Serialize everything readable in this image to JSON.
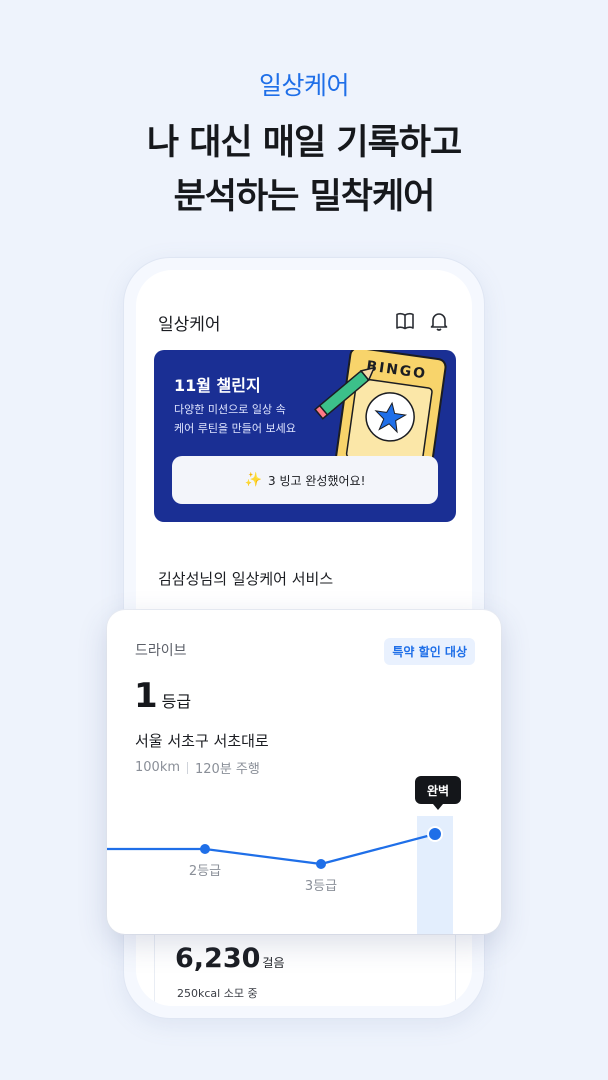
{
  "hero": {
    "eyebrow": "일상케어",
    "headline_line1": "나 대신 매일 기록하고",
    "headline_line2": "분석하는 밀착케어"
  },
  "app": {
    "title": "일상케어",
    "icons": [
      "book-icon",
      "bell-icon"
    ]
  },
  "banner": {
    "title": "11월 챌린지",
    "description_line1": "다양한 미션으로 일상 속",
    "description_line2": "케어 루틴을 만들어 보세요",
    "art_text": "BINGO",
    "button_label": "3 빙고 완성했어요!",
    "button_icon": "sparkle-icon"
  },
  "service": {
    "title": "김삼성님의 일상케어 서비스"
  },
  "drive": {
    "label": "드라이브",
    "badge": "특약 할인 대상",
    "grade_value": "1",
    "grade_unit": "등급",
    "address": "서울 서초구 서초대로",
    "distance": "100km",
    "duration": "120분 주행",
    "tooltip": "완벽"
  },
  "steps": {
    "value": "6,230",
    "unit": "걸음",
    "sub": "250kcal 소모 중"
  },
  "colors": {
    "accent": "#1f6fe8",
    "banner": "#1a2f94",
    "background": "#eef3fc"
  },
  "chart_data": {
    "type": "line",
    "categories": [
      "",
      "2등급",
      "3등급",
      "1등급"
    ],
    "values": [
      2,
      2,
      3,
      1
    ],
    "point_labels": [
      "",
      "2등급",
      "3등급",
      ""
    ],
    "y_inverted": true,
    "highlight_index": 3,
    "ylim": [
      1,
      3
    ]
  }
}
